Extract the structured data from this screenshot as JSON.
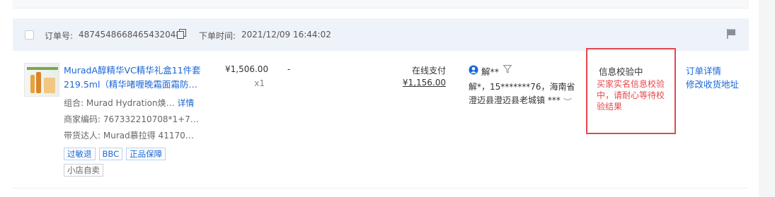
{
  "order": {
    "order_no_label": "订单号:",
    "order_no": "4874548668465432048",
    "created_label": "下单时间:",
    "created_time": "2021/12/09 16:44:02"
  },
  "product": {
    "title": "MuradA醇精华VC精华礼盒11件套219.5ml（精华啫喱晚霜面霜防…",
    "combo_label": "组合:",
    "combo_value": "Murad Hydration焕…",
    "detail_link": "详情",
    "merchant_code_label": "商家编码:",
    "merchant_code": "767332210708*1+7…",
    "promoter_label": "带货达人:",
    "promoter": "Murad慕拉得 41170…",
    "tags": [
      "过敏退",
      "BBC",
      "正品保障"
    ],
    "shop_tag": "小店自卖",
    "unit_price": "¥1,506.00",
    "quantity": "x1"
  },
  "after_sale": "-",
  "payment": {
    "type": "在线支付",
    "amount": "¥1,156.00"
  },
  "buyer": {
    "name": "解**",
    "address": "解*，15*******76，海南省澄迈县澄迈县老城镇 ***"
  },
  "verification": {
    "status": "信息校验中",
    "description": "买家实名信息校验中，请耐心等待校验结果"
  },
  "actions": {
    "order_detail": "订单详情",
    "modify_address": "修改收货地址"
  },
  "colors": {
    "link": "#1a66d6",
    "alert_red": "#e5484d",
    "header_bg": "#eef2f9"
  },
  "icons": [
    "copy-icon",
    "flag-icon",
    "buyer-avatar-icon",
    "filter-icon",
    "eye-icon"
  ]
}
